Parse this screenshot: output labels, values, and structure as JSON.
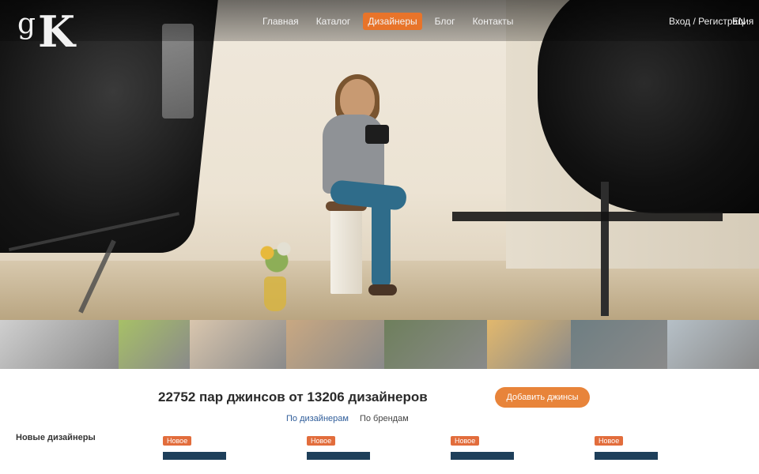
{
  "header": {
    "logo_text": "GK",
    "tagline": "",
    "nav": [
      {
        "label": "Главная",
        "active": false
      },
      {
        "label": "Каталог",
        "active": false
      },
      {
        "label": "Дизайнеры",
        "active": true
      },
      {
        "label": "Блог",
        "active": false
      },
      {
        "label": "Контакты",
        "active": false
      }
    ],
    "login": "Вход / Регистрация",
    "lang": "EN"
  },
  "hero": {
    "caption": ""
  },
  "thumbnails": [
    {
      "color": "#cfcfcf"
    },
    {
      "color": "#a7c067"
    },
    {
      "color": "#d9c6ae"
    },
    {
      "color": "#c9a882"
    },
    {
      "color": "#6e7f5c"
    },
    {
      "color": "#e2b86d"
    },
    {
      "color": "#6e7e82"
    },
    {
      "color": "#b6c0c7"
    }
  ],
  "main": {
    "headline": "22752 пар джинсов от 13206 дизайнеров",
    "cta": "Добавить джинсы",
    "tabs": [
      {
        "label": "По дизайнерам",
        "active": false
      },
      {
        "label": "По брендам",
        "active": true
      }
    ]
  },
  "sidebar": {
    "title": "Новые дизайнеры",
    "links": [
      "",
      ""
    ]
  },
  "cards": [
    {
      "badge": "Новое",
      "date": "",
      "title": ""
    },
    {
      "badge": "Новое",
      "date": "",
      "title": ""
    },
    {
      "badge": "Новое",
      "date": "",
      "title": ""
    },
    {
      "badge": "Новое",
      "date": "",
      "title": ""
    }
  ],
  "colors": {
    "accent": "#e8742a",
    "link": "#2f5d9a"
  }
}
